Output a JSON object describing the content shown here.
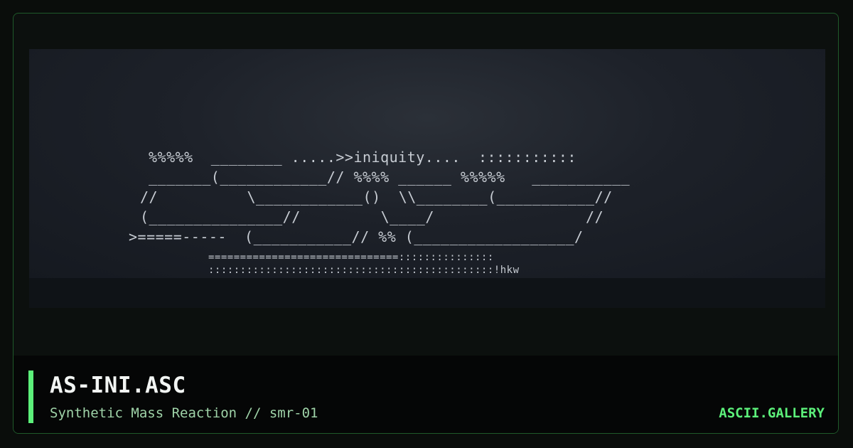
{
  "artwork": {
    "lines": [
      "%%%%%  ________ .....>>iniquity....  :::::::::::",
      "_______(____________// %%%% ______ %%%%%   ___________",
      "//          \\____________()  \\\\________(___________//",
      "(_______________//         \\____/                 //",
      ">=====-----  (___________// %% (__________________/",
      "==============================:::::::::::::::",
      ":::::::::::::::::::::::::::::::::::::::::::::!hkw"
    ]
  },
  "footer": {
    "title": "AS-INI.ASC",
    "subtitle": "Synthetic Mass Reaction // smr-01",
    "brand": "ASCII.GALLERY"
  },
  "colors": {
    "accent": "#5cf07a",
    "background": "#0a0d0b",
    "border": "#1f5a2a",
    "text": "#f2f5f3",
    "subtitle": "#9fd3a8"
  }
}
